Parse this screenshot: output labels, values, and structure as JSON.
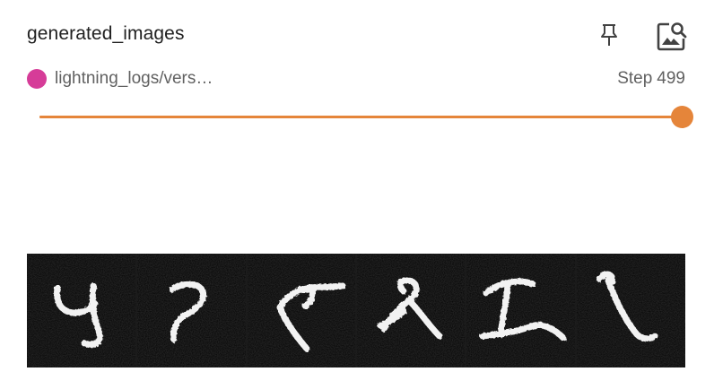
{
  "card": {
    "title": "generated_images",
    "pin_icon": "pin-icon",
    "fullscreen_icon": "image-search-icon"
  },
  "run": {
    "name": "lightning_logs/vers…",
    "color": "#d63c98"
  },
  "step": {
    "prefix": "Step",
    "value": "499"
  },
  "slider": {
    "color": "#e5853a",
    "progress": 1.0
  },
  "image": {
    "description_icon": "generated-digits-image",
    "tiles": 6
  }
}
